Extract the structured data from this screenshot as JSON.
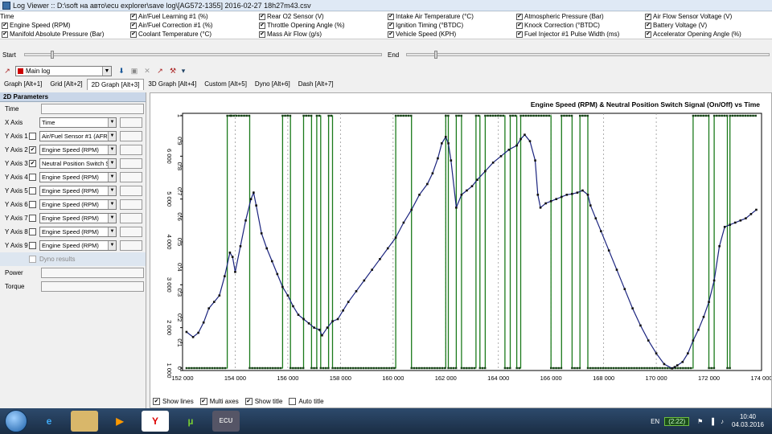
{
  "window": {
    "title": "Log Viewer :: D:\\soft на авто\\ecu explorer\\save log\\[AG572-1355] 2016-02-27 18h27m43.csv"
  },
  "parameters": [
    [
      {
        "label": "Time",
        "checked": false,
        "nocheck": true
      },
      {
        "label": "Air/Fuel Learning #1 (%)",
        "checked": true
      },
      {
        "label": "Rear O2 Sensor (V)",
        "checked": true
      },
      {
        "label": "Intake Air Temperature (°C)",
        "checked": true
      },
      {
        "label": "Atmospheric Pressure (Bar)",
        "checked": true
      },
      {
        "label": "Air Flow Sensor Voltage (V)",
        "checked": true
      }
    ],
    [
      {
        "label": "Engine Speed (RPM)",
        "checked": true
      },
      {
        "label": "Air/Fuel Correction #1 (%)",
        "checked": true
      },
      {
        "label": "Throttle Opening Angle (%)",
        "checked": true
      },
      {
        "label": "Ignition Timing (°BTDC)",
        "checked": true
      },
      {
        "label": "Knock Correction (°BTDC)",
        "checked": true
      },
      {
        "label": "Battery Voltage (V)",
        "checked": true
      }
    ],
    [
      {
        "label": "Manifold Absolute Pressure (Bar)",
        "checked": true
      },
      {
        "label": "Coolant Temperature (°C)",
        "checked": true
      },
      {
        "label": "Mass Air Flow (g/s)",
        "checked": true
      },
      {
        "label": "Vehicle Speed (KPH)",
        "checked": true
      },
      {
        "label": "Fuel Injector #1 Pulse Width (ms)",
        "checked": true
      },
      {
        "label": "Accelerator Opening Angle (%)",
        "checked": true
      }
    ]
  ],
  "range": {
    "start_label": "Start",
    "end_label": "End"
  },
  "toolbar": {
    "log_name": "Main log"
  },
  "tabs": [
    {
      "label": "Graph [Alt+1]",
      "active": false
    },
    {
      "label": "Grid [Alt+2]",
      "active": false
    },
    {
      "label": "2D Graph [Alt+3]",
      "active": true
    },
    {
      "label": "3D Graph [Alt+4]",
      "active": false
    },
    {
      "label": "Custom [Alt+5]",
      "active": false
    },
    {
      "label": "Dyno [Alt+6]",
      "active": false
    },
    {
      "label": "Dash [Alt+7]",
      "active": false
    }
  ],
  "panel": {
    "header": "2D Parameters",
    "time_label": "Time",
    "xaxis": {
      "label": "X Axis",
      "value": "Time"
    },
    "yaxes": [
      {
        "label": "Y Axis 1",
        "checked": false,
        "value": "Air/Fuel Sensor #1 (AFR)"
      },
      {
        "label": "Y Axis 2",
        "checked": true,
        "value": "Engine Speed (RPM)"
      },
      {
        "label": "Y Axis 3",
        "checked": true,
        "value": "Neutral Position Switch Signal"
      },
      {
        "label": "Y Axis 4",
        "checked": false,
        "value": "Engine Speed (RPM)"
      },
      {
        "label": "Y Axis 5",
        "checked": false,
        "value": "Engine Speed (RPM)"
      },
      {
        "label": "Y Axis 6",
        "checked": false,
        "value": "Engine Speed (RPM)"
      },
      {
        "label": "Y Axis 7",
        "checked": false,
        "value": "Engine Speed (RPM)"
      },
      {
        "label": "Y Axis 8",
        "checked": false,
        "value": "Engine Speed (RPM)"
      },
      {
        "label": "Y Axis 9",
        "checked": false,
        "value": "Engine Speed (RPM)"
      }
    ],
    "dyno_label": "Dyno results",
    "power_label": "Power",
    "torque_label": "Torque"
  },
  "options": [
    {
      "label": "Show lines",
      "checked": true
    },
    {
      "label": "Multi axes",
      "checked": true
    },
    {
      "label": "Show title",
      "checked": true
    },
    {
      "label": "Auto title",
      "checked": false
    }
  ],
  "taskbar": {
    "lang": "EN",
    "battery": "(2:22)",
    "time": "10:40",
    "date": "04.03.2016"
  },
  "chart_data": {
    "type": "line",
    "title": "Engine Speed (RPM) & Neutral Position Switch Signal (On/Off) vs Time",
    "xlim": [
      152000,
      174000
    ],
    "x_ticks": [
      "152 000",
      "154 000",
      "156 000",
      "158 000",
      "160 000",
      "162 000",
      "164 000",
      "166 000",
      "168 000",
      "170 000",
      "172 000",
      "174 000"
    ],
    "y_rpm_lim": [
      1000,
      7000
    ],
    "y_rpm_ticks": [
      "1 000",
      "2 000",
      "3 000",
      "4 000",
      "5 000",
      "6 000"
    ],
    "y_nps_lim": [
      0,
      1
    ],
    "y_nps_ticks": [
      "0",
      "0.1",
      "0.2",
      "0.3",
      "0.4",
      "0.5",
      "0.6",
      "0.7",
      "0.8",
      "0.9",
      "1"
    ],
    "colors": {
      "rpm": "#1a237e",
      "nps": "#1b7a1b",
      "grid": "#999999"
    },
    "series": [
      {
        "name": "Engine Speed (RPM)",
        "x": [
          152150,
          152400,
          152600,
          152800,
          153000,
          153200,
          153400,
          153600,
          153800,
          153900,
          154000,
          154200,
          154400,
          154600,
          154700,
          154800,
          155000,
          155200,
          155400,
          155600,
          155800,
          156000,
          156200,
          156400,
          156600,
          156800,
          157000,
          157200,
          157300,
          157500,
          157700,
          157900,
          158100,
          158300,
          158600,
          158900,
          159200,
          159500,
          159800,
          160100,
          160400,
          160700,
          161000,
          161300,
          161500,
          161700,
          161850,
          162000,
          162100,
          162200,
          162400,
          162600,
          162800,
          163000,
          163200,
          163500,
          163800,
          164100,
          164400,
          164700,
          164850,
          165000,
          165200,
          165400,
          165500,
          165600,
          165800,
          166000,
          166200,
          166400,
          166600,
          166800,
          167000,
          167200,
          167400,
          167500,
          167700,
          167900,
          168200,
          168500,
          168800,
          169100,
          169400,
          169700,
          170000,
          170300,
          170600,
          170700,
          170800,
          171000,
          171200,
          171400,
          171600,
          171800,
          172000,
          172200,
          172400,
          172600,
          172800,
          173000,
          173200,
          173400,
          173600,
          173800
        ],
        "y": [
          1900,
          1780,
          1880,
          2120,
          2450,
          2600,
          2750,
          3200,
          3750,
          3650,
          3300,
          3900,
          4500,
          5000,
          5150,
          4850,
          4200,
          3850,
          3550,
          3250,
          2950,
          2750,
          2500,
          2300,
          2200,
          2100,
          2000,
          1950,
          1820,
          2000,
          2150,
          2200,
          2400,
          2600,
          2850,
          3100,
          3350,
          3600,
          3850,
          4100,
          4450,
          4750,
          5100,
          5350,
          5600,
          5950,
          6300,
          6450,
          6300,
          5900,
          4800,
          5100,
          5200,
          5300,
          5450,
          5650,
          5850,
          6000,
          6150,
          6250,
          6400,
          6500,
          6350,
          5900,
          5100,
          4800,
          4900,
          4950,
          5000,
          5050,
          5100,
          5120,
          5150,
          5200,
          5100,
          4850,
          4550,
          4250,
          3800,
          3350,
          2900,
          2450,
          2050,
          1700,
          1400,
          1150,
          1050,
          1080,
          1120,
          1200,
          1400,
          1700,
          1950,
          2250,
          2600,
          3100,
          3900,
          4350,
          4400,
          4450,
          4500,
          4550,
          4650,
          4750
        ]
      },
      {
        "name": "Neutral Position Switch Signal (On/Off)",
        "x": [
          152150,
          153700,
          153700,
          153850,
          153850,
          154550,
          154550,
          155800,
          155800,
          156100,
          156100,
          156600,
          156600,
          156900,
          156900,
          157100,
          157100,
          157250,
          157250,
          157550,
          157550,
          157700,
          157700,
          160100,
          160100,
          160700,
          160700,
          162000,
          162000,
          162100,
          162100,
          162400,
          162400,
          162600,
          162600,
          163150,
          163150,
          163300,
          163300,
          163500,
          163500,
          164250,
          164250,
          164450,
          164450,
          164700,
          164700,
          164850,
          164850,
          166000,
          166000,
          166400,
          166400,
          166800,
          166800,
          167100,
          167100,
          167400,
          167400,
          171400,
          171400,
          172000,
          172000,
          172200,
          172200,
          172700,
          172700,
          172800,
          172800,
          173800
        ],
        "y": [
          0,
          0,
          1,
          1,
          1,
          1,
          0,
          0,
          1,
          1,
          0,
          0,
          1,
          1,
          0,
          0,
          1,
          1,
          0,
          0,
          1,
          1,
          0,
          0,
          1,
          1,
          0,
          0,
          1,
          1,
          0,
          0,
          1,
          1,
          0,
          0,
          1,
          1,
          0,
          0,
          1,
          1,
          0,
          0,
          1,
          1,
          0,
          0,
          1,
          1,
          0,
          0,
          1,
          1,
          0,
          0,
          1,
          1,
          0,
          0,
          1,
          1,
          0,
          0,
          1,
          1,
          0,
          0,
          1,
          1
        ]
      }
    ]
  }
}
